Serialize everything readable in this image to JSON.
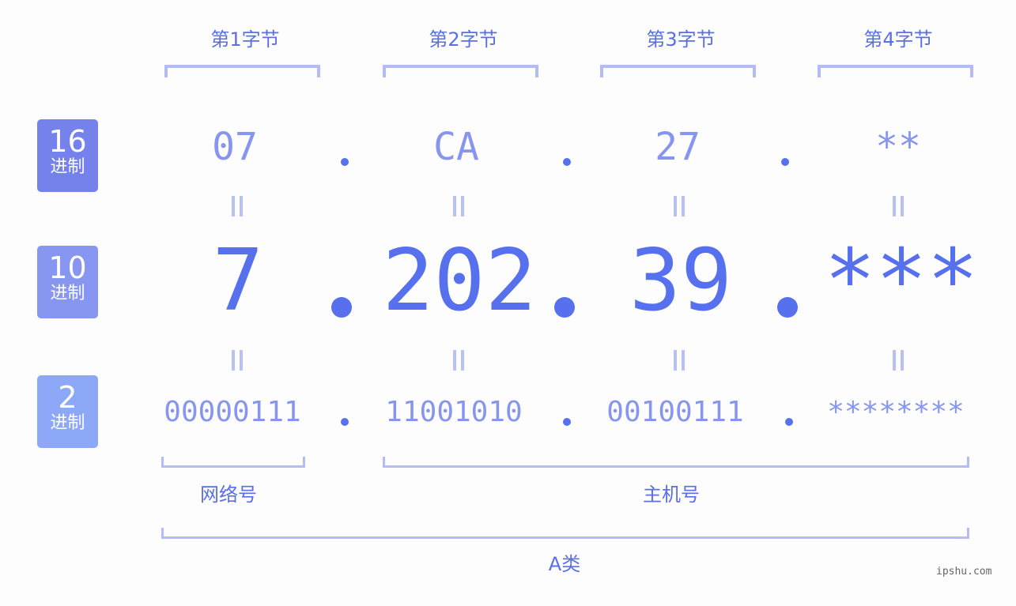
{
  "byte_headers": [
    "第1字节",
    "第2字节",
    "第3字节",
    "第4字节"
  ],
  "badges": [
    {
      "num": "16",
      "unit": "进制",
      "color": "#7582ec"
    },
    {
      "num": "10",
      "unit": "进制",
      "color": "#8696f1"
    },
    {
      "num": "2",
      "unit": "进制",
      "color": "#8ea8f8"
    }
  ],
  "hex": [
    "07",
    "CA",
    "27",
    "**"
  ],
  "decimal": [
    "7",
    "202",
    "39",
    "***"
  ],
  "binary": [
    "00000111",
    "11001010",
    "00100111",
    "********"
  ],
  "equals_symbol": "=",
  "labels": {
    "network": "网络号",
    "host": "主机号",
    "class": "A类"
  },
  "watermark": "ipshu.com",
  "colors": {
    "accent": "#5670ee",
    "light": "#8795f0",
    "bracket": "#b3bcf6"
  }
}
